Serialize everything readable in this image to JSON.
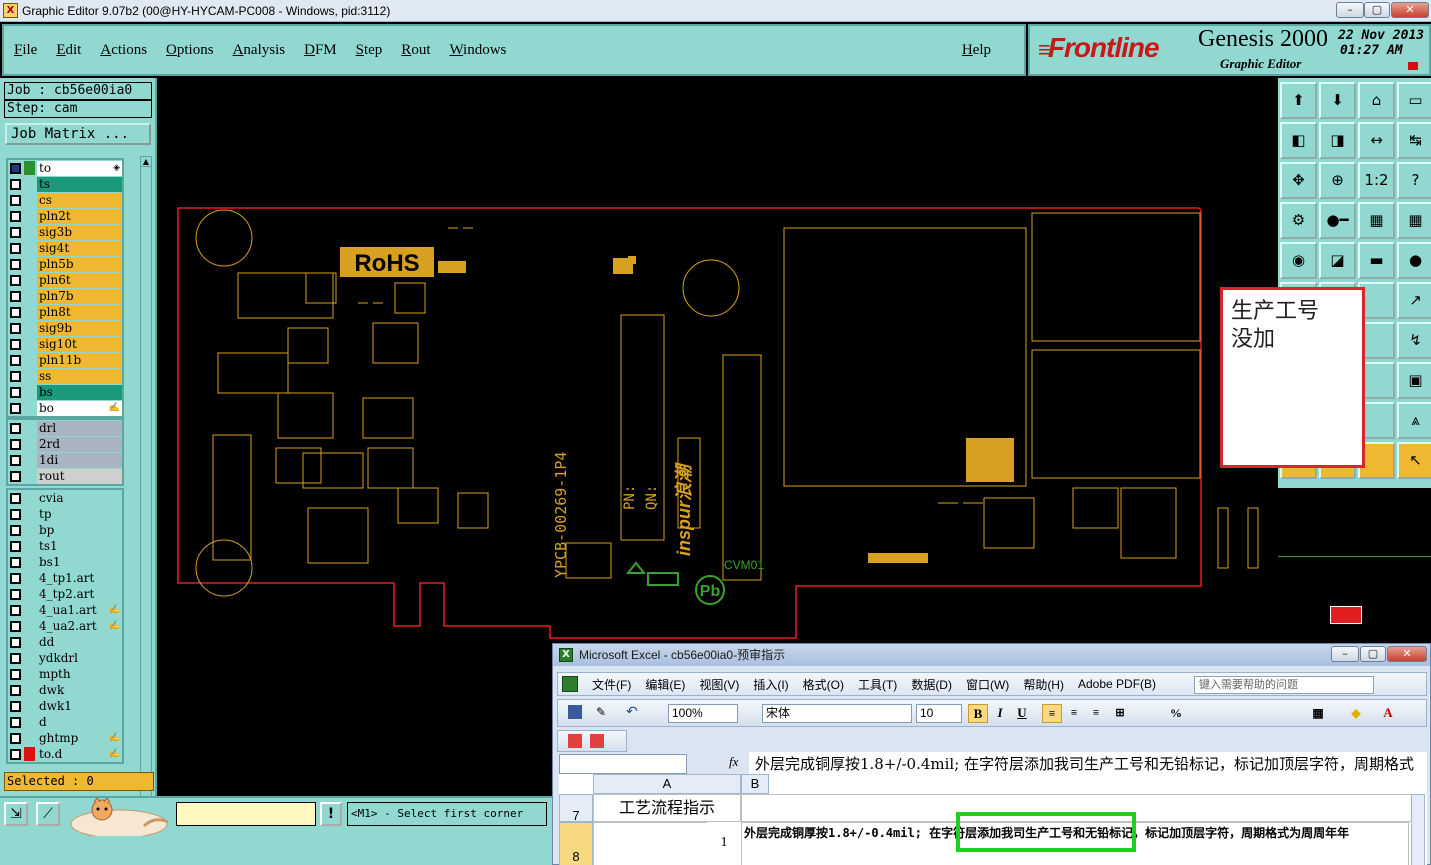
{
  "window": {
    "title": "Graphic Editor 9.07b2 (00@HY-HYCAM-PC008 - Windows, pid:3112)",
    "icon_letter": "X",
    "min": "–",
    "max": "▢",
    "close": "✕"
  },
  "menu": {
    "items": [
      "File",
      "Edit",
      "Actions",
      "Options",
      "Analysis",
      "DFM",
      "Step",
      "Rout",
      "Windows"
    ],
    "help": "Help"
  },
  "brand": {
    "logo": "Frontline",
    "product": "Genesis 2000",
    "subtitle": "Graphic Editor",
    "date": "22 Nov 2013",
    "time": "01:27 AM"
  },
  "job": {
    "job_line": "Job : cb56e00ia0",
    "step_line": "Step: cam",
    "matrix_button": "Job Matrix ..."
  },
  "layers": {
    "group1": [
      {
        "name": "to",
        "color": "#ffffff",
        "sw": "#2f8f2f",
        "mark": "◈"
      },
      {
        "name": "ts",
        "color": "#1a9a7a",
        "sw": ""
      },
      {
        "name": "cs",
        "color": "#f0b830",
        "sw": ""
      },
      {
        "name": "pln2t",
        "color": "#f0b830",
        "sw": ""
      },
      {
        "name": "sig3b",
        "color": "#f0b830",
        "sw": ""
      },
      {
        "name": "sig4t",
        "color": "#f0b830",
        "sw": ""
      },
      {
        "name": "pln5b",
        "color": "#f0b830",
        "sw": ""
      },
      {
        "name": "pln6t",
        "color": "#f0b830",
        "sw": ""
      },
      {
        "name": "pln7b",
        "color": "#f0b830",
        "sw": ""
      },
      {
        "name": "pln8t",
        "color": "#f0b830",
        "sw": ""
      },
      {
        "name": "sig9b",
        "color": "#f0b830",
        "sw": ""
      },
      {
        "name": "sig10t",
        "color": "#f0b830",
        "sw": ""
      },
      {
        "name": "pln11b",
        "color": "#f0b830",
        "sw": ""
      },
      {
        "name": "ss",
        "color": "#f0b830",
        "sw": ""
      },
      {
        "name": "bs",
        "color": "#1a9a7a",
        "sw": ""
      },
      {
        "name": "bo",
        "color": "#ffffff",
        "sw": "",
        "mark": "✍"
      }
    ],
    "group2": [
      {
        "name": "drl",
        "color": "#a8b4c0",
        "sw": ""
      },
      {
        "name": "2rd",
        "color": "#a8b4c0",
        "sw": ""
      },
      {
        "name": "1di",
        "color": "#a8b4c0",
        "sw": ""
      },
      {
        "name": "rout",
        "color": "#cfcfcf",
        "sw": ""
      }
    ],
    "group3": [
      {
        "name": "cvia",
        "color": "#90d8d0",
        "sw": ""
      },
      {
        "name": "tp",
        "color": "#90d8d0",
        "sw": ""
      },
      {
        "name": "bp",
        "color": "#90d8d0",
        "sw": ""
      },
      {
        "name": "ts1",
        "color": "#90d8d0",
        "sw": ""
      },
      {
        "name": "bs1",
        "color": "#90d8d0",
        "sw": ""
      },
      {
        "name": "4_tp1.art",
        "color": "#90d8d0",
        "sw": ""
      },
      {
        "name": "4_tp2.art",
        "color": "#90d8d0",
        "sw": ""
      },
      {
        "name": "4_ua1.art",
        "color": "#90d8d0",
        "sw": "",
        "mark": "✍"
      },
      {
        "name": "4_ua2.art",
        "color": "#90d8d0",
        "sw": "",
        "mark": "✍"
      },
      {
        "name": "dd",
        "color": "#90d8d0",
        "sw": ""
      },
      {
        "name": "ydkdrl",
        "color": "#90d8d0",
        "sw": ""
      },
      {
        "name": "mpth",
        "color": "#90d8d0",
        "sw": ""
      },
      {
        "name": "dwk",
        "color": "#90d8d0",
        "sw": ""
      },
      {
        "name": "dwk1",
        "color": "#90d8d0",
        "sw": ""
      },
      {
        "name": "d",
        "color": "#90d8d0",
        "sw": ""
      },
      {
        "name": "ghtmp",
        "color": "#90d8d0",
        "sw": "",
        "mark": "✍"
      },
      {
        "name": "to.d",
        "color": "#90d8d0",
        "sw": "#e01010",
        "mark": "✍"
      }
    ]
  },
  "selected": "Selected : 0",
  "prompt": "<M1> - Select first corner",
  "tools": [
    "⬆",
    "⬇",
    "⌂",
    "▭",
    "◧",
    "◨",
    "↔",
    "↹",
    "✥",
    "⊕",
    "1:2",
    "?",
    "⚙",
    "●━",
    "▦",
    "▦",
    "◉",
    "◪",
    "▬",
    "●",
    "",
    "↗",
    "",
    "↗",
    "",
    "↻",
    "",
    "↯",
    "",
    "⊡",
    "",
    "▣",
    "",
    "⩓",
    "",
    "⩓",
    "",
    "↖",
    "",
    "↖"
  ],
  "board": {
    "rohs": "RoHS",
    "pcb_id": "YPCB-00269-1P4",
    "brand_mark": "inspur浪潮",
    "pb": "Pb",
    "cvm": "CVM01",
    "pn": "PN:",
    "qn": "QN:"
  },
  "note": {
    "line1": "生产工号",
    "line2": "没加"
  },
  "excel": {
    "title": "Microsoft Excel - cb56e00ia0-预审指示",
    "menus": [
      "文件(F)",
      "编辑(E)",
      "视图(V)",
      "插入(I)",
      "格式(O)",
      "工具(T)",
      "数据(D)",
      "窗口(W)",
      "帮助(H)",
      "Adobe PDF(B)"
    ],
    "help_placeholder": "键入需要帮助的问题",
    "zoom": "100%",
    "font": "宋体",
    "size": "10",
    "fx": "fx",
    "formula": "外层完成铜厚按1.8+/-0.4mil;  在字符层添加我司生产工号和无铅标记，标记加顶层字符，周期格式为周周年年",
    "col_a": "A",
    "col_b": "B",
    "row7": "7",
    "row8": "8",
    "a7": "工艺流程指示",
    "b8": "1",
    "c8": "外层完成铜厚按1.8+/-0.4mil;  在字符层添加我司生产工号和无铅标记，标记加顶层字符，周期格式为周周年年",
    "highlight": "在字符层添加我司生产工号"
  }
}
